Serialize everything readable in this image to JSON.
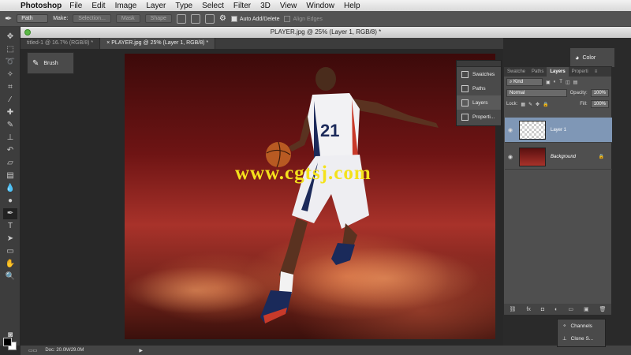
{
  "menubar": {
    "app": "Photoshop",
    "items": [
      "File",
      "Edit",
      "Image",
      "Layer",
      "Type",
      "Select",
      "Filter",
      "3D",
      "View",
      "Window",
      "Help"
    ]
  },
  "options": {
    "mode": "Path",
    "make_label": "Make:",
    "selection": "Selection...",
    "mask": "Mask",
    "shape": "Shape",
    "auto_add": "Auto Add/Delete",
    "align_edges": "Align Edges"
  },
  "window_title": "PLAYER.jpg @ 25% (Layer 1, RGB/8) *",
  "tabs": [
    {
      "label": "titled-1 @ 16.7% (RGB/8) *",
      "close": "×"
    },
    {
      "label": "PLAYER.jpg @ 25% (Layer 1, RGB/8) *",
      "close": "×"
    }
  ],
  "brush_panel": {
    "label": "Brush"
  },
  "watermark": "www.cgtsj.com",
  "jersey_number": "21",
  "status": {
    "doc": "Doc: 20.0M/29.0M"
  },
  "color_panel": {
    "label": "Color"
  },
  "float_panel": {
    "items": [
      {
        "label": "Swatches",
        "icon": "swatches-icon"
      },
      {
        "label": "Paths",
        "icon": "paths-icon"
      },
      {
        "label": "Layers",
        "icon": "layers-icon"
      },
      {
        "label": "Properti...",
        "icon": "properties-icon"
      }
    ]
  },
  "layers_panel": {
    "tabs": [
      "Swatche",
      "Paths",
      "Layers",
      "Properti"
    ],
    "kind": "Kind",
    "blend": "Normal",
    "opacity_label": "Opacity:",
    "opacity": "100%",
    "lock_label": "Lock:",
    "fill_label": "Fill:",
    "fill": "100%",
    "layers": [
      {
        "name": "Layer 1"
      },
      {
        "name": "Background"
      }
    ]
  },
  "channels_panel": {
    "items": [
      {
        "label": "Channels"
      },
      {
        "label": "Clone S..."
      }
    ]
  },
  "colors": {
    "accent": "#7f97b6",
    "watermark": "#f4e21c"
  }
}
